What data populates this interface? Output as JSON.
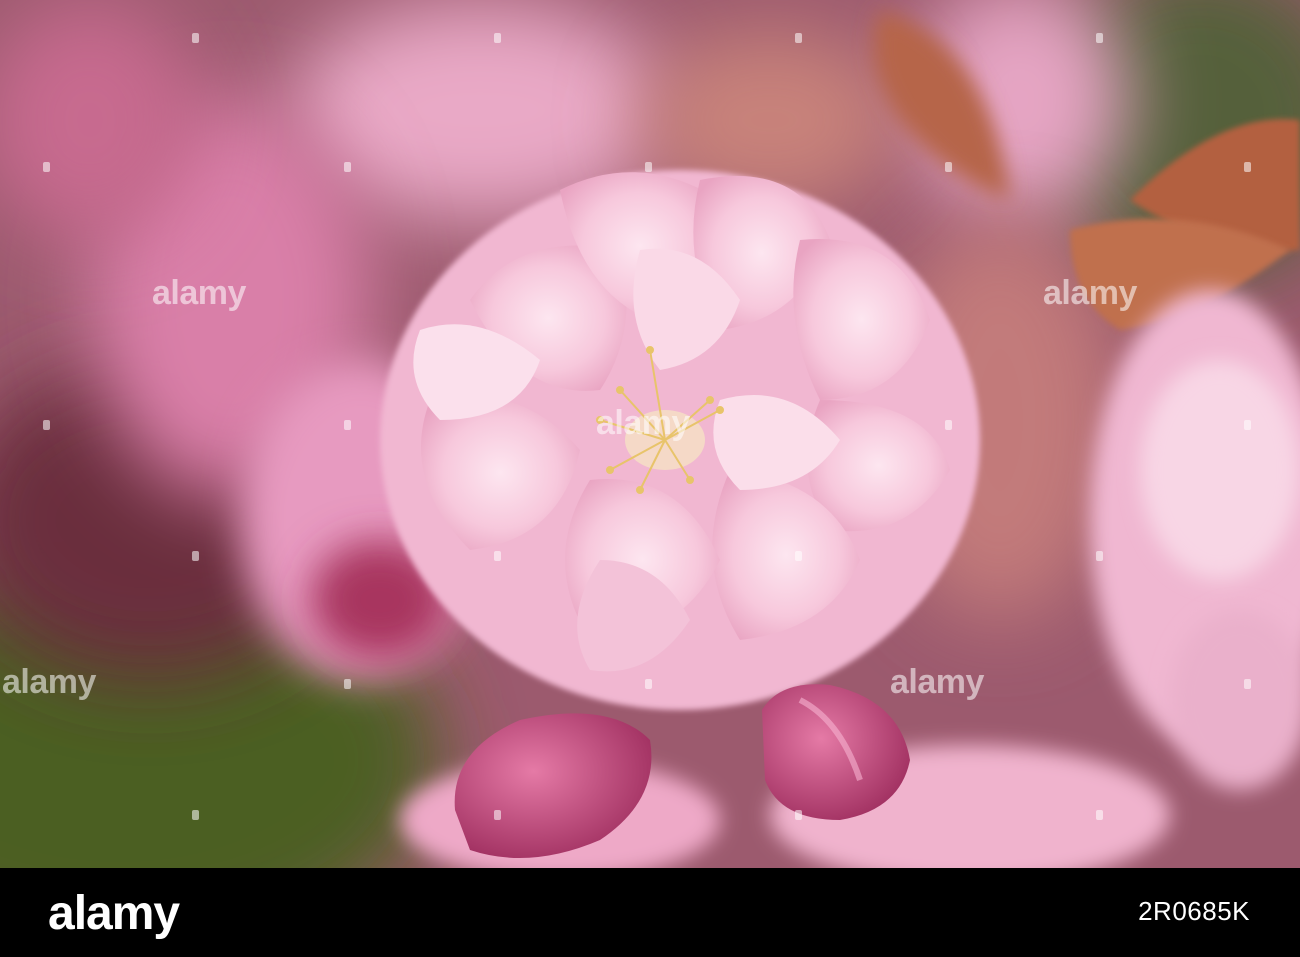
{
  "watermark": {
    "text": "alamy",
    "marks": [
      "alamy",
      "alamy",
      "alamy",
      "alamy",
      "alamy",
      "alamy",
      "alamy"
    ]
  },
  "footer": {
    "logo": "alamy",
    "image_id": "2R0685K"
  },
  "colors": {
    "petal": "#f4bfd6",
    "petal_light": "#fbe0ec",
    "bud": "#c9457e",
    "leaf": "#b35f45",
    "background_green": "#4a5a25",
    "footer_bg": "#000000"
  }
}
